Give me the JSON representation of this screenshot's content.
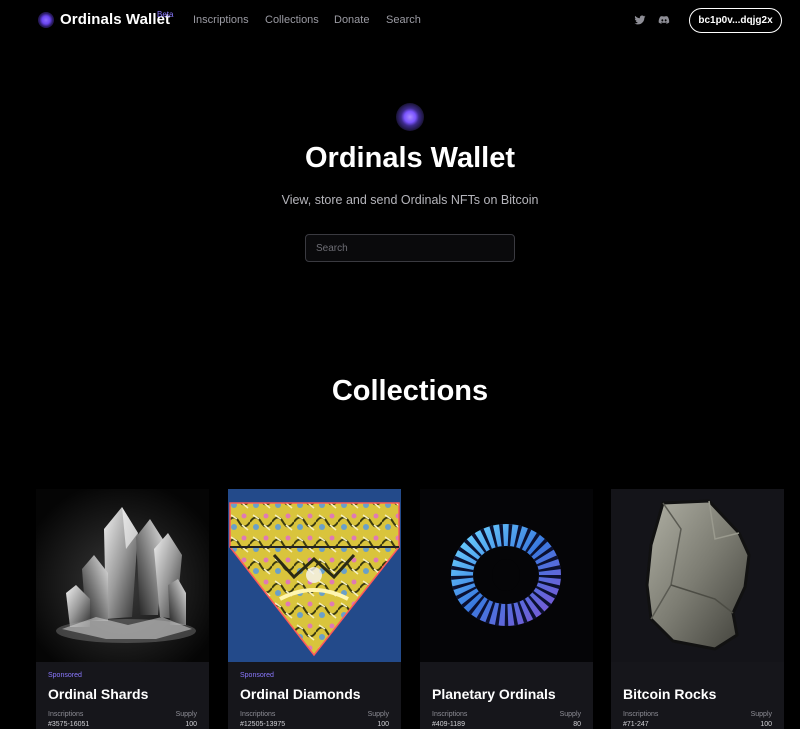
{
  "nav": {
    "brand": "Ordinals Wallet",
    "beta": "Beta",
    "links": [
      "Inscriptions",
      "Collections",
      "Donate",
      "Search"
    ],
    "social_icons": [
      "twitter-icon",
      "discord-icon"
    ],
    "wallet_address": "bc1p0v...dqjg2x"
  },
  "hero": {
    "title": "Ordinals Wallet",
    "subtitle": "View, store and send Ordinals NFTs on Bitcoin",
    "search_placeholder": "Search"
  },
  "collections": {
    "title": "Collections",
    "label_inscriptions": "Inscriptions",
    "label_supply": "Supply",
    "items": [
      {
        "badge": "Sponsored",
        "name": "Ordinal Shards",
        "inscriptions": "#3575-16051",
        "supply": "100"
      },
      {
        "badge": "Sponsored",
        "name": "Ordinal Diamonds",
        "inscriptions": "#12505-13975",
        "supply": "100"
      },
      {
        "badge": "",
        "name": "Planetary Ordinals",
        "inscriptions": "#409-1189",
        "supply": "80"
      },
      {
        "badge": "",
        "name": "Bitcoin Rocks",
        "inscriptions": "#71-247",
        "supply": "100"
      }
    ]
  },
  "colors": {
    "background": "#000000",
    "card": "#16161b",
    "accent": "#8a78ff"
  }
}
